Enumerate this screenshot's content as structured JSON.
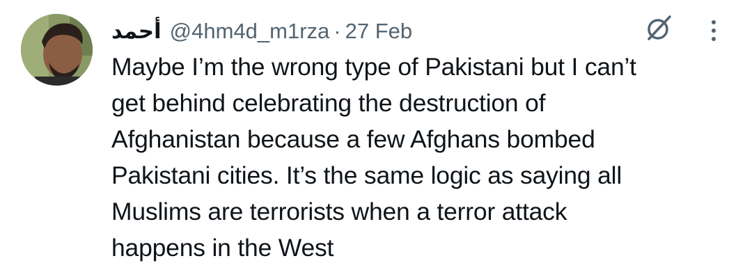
{
  "tweet": {
    "display_name": "أحمد",
    "handle": "@4hm4d_m1rza",
    "separator": "·",
    "date": "27 Feb",
    "lines": [
      "Maybe I’m the wrong type of Pakistani but I can’t",
      "get behind celebrating the destruction of",
      "Afghanistan because a few Afghans bombed",
      "Pakistani cities. It’s the same logic as saying all",
      "Muslims are terrorists when a terror attack",
      "happens in the West"
    ]
  },
  "icons": {
    "grok": "grok-icon",
    "more": "more-options-icon"
  },
  "colors": {
    "text": "#0f1419",
    "secondary": "#536471",
    "icon": "#536471",
    "background": "#ffffff"
  }
}
